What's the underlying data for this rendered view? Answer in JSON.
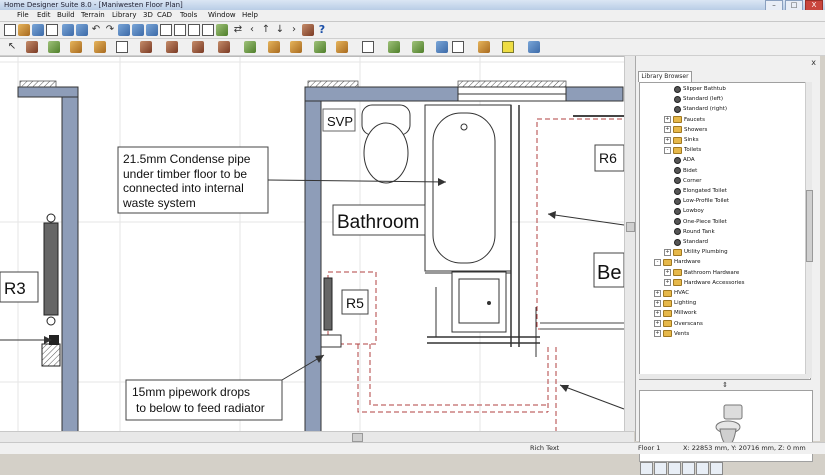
{
  "window": {
    "title": "Home Designer Suite 8.0 - [Maniwesten Floor Plan]",
    "controls": {
      "minimize": "–",
      "maximize": "□",
      "close": "X"
    }
  },
  "menu": [
    "File",
    "Edit",
    "Build",
    "Terrain",
    "Library",
    "3D",
    "CAD",
    "Tools",
    "Window",
    "Help"
  ],
  "toolbar": {
    "help_label": "?"
  },
  "plan": {
    "room_name": "Bathroom",
    "labels": {
      "svp": "SVP",
      "r3": "R3",
      "r5": "R5",
      "r6": "R6",
      "be": "Be"
    },
    "callout_pipe": [
      "21.5mm Condense pipe",
      "under timber floor to be",
      "connected into internal",
      "waste system"
    ],
    "callout_radiator": [
      "15mm pipework drops",
      "to below to feed radiator"
    ]
  },
  "library": {
    "tab_label": "Library Browser",
    "close": "x",
    "items": [
      {
        "label": "Slipper Bathtub",
        "type": "item",
        "level": 3
      },
      {
        "label": "Standard (left)",
        "type": "item",
        "level": 3
      },
      {
        "label": "Standard (right)",
        "type": "item",
        "level": 3
      },
      {
        "label": "Faucets",
        "type": "folder",
        "level": 2
      },
      {
        "label": "Showers",
        "type": "folder",
        "level": 2
      },
      {
        "label": "Sinks",
        "type": "folder",
        "level": 2
      },
      {
        "label": "Toilets",
        "type": "folder-open",
        "level": 2
      },
      {
        "label": "ADA",
        "type": "item",
        "level": 3
      },
      {
        "label": "Bidet",
        "type": "item",
        "level": 3
      },
      {
        "label": "Corner",
        "type": "item",
        "level": 3
      },
      {
        "label": "Elongated Toilet",
        "type": "item",
        "level": 3
      },
      {
        "label": "Low-Profile Toilet",
        "type": "item",
        "level": 3
      },
      {
        "label": "Lowboy",
        "type": "item",
        "level": 3
      },
      {
        "label": "One-Piece Toilet",
        "type": "item",
        "level": 3
      },
      {
        "label": "Round Tank",
        "type": "item",
        "level": 3
      },
      {
        "label": "Standard",
        "type": "item",
        "level": 3
      },
      {
        "label": "Utility Plumbing",
        "type": "folder",
        "level": 2
      },
      {
        "label": "Hardware",
        "type": "folder-open",
        "level": 1
      },
      {
        "label": "Bathroom Hardware",
        "type": "folder",
        "level": 2
      },
      {
        "label": "Hardware Accessories",
        "type": "folder",
        "level": 2
      },
      {
        "label": "HVAC",
        "type": "folder",
        "level": 1
      },
      {
        "label": "Lighting",
        "type": "folder",
        "level": 1
      },
      {
        "label": "Millwork",
        "type": "folder",
        "level": 1
      },
      {
        "label": "Overscans",
        "type": "folder",
        "level": 1
      },
      {
        "label": "Vents",
        "type": "folder",
        "level": 1
      }
    ],
    "divider_glyph": "⇕"
  },
  "status": {
    "mode": "Rich Text",
    "floor": "Floor 1",
    "coords": "X: 22853 mm, Y: 20716 mm, Z: 0 mm"
  }
}
